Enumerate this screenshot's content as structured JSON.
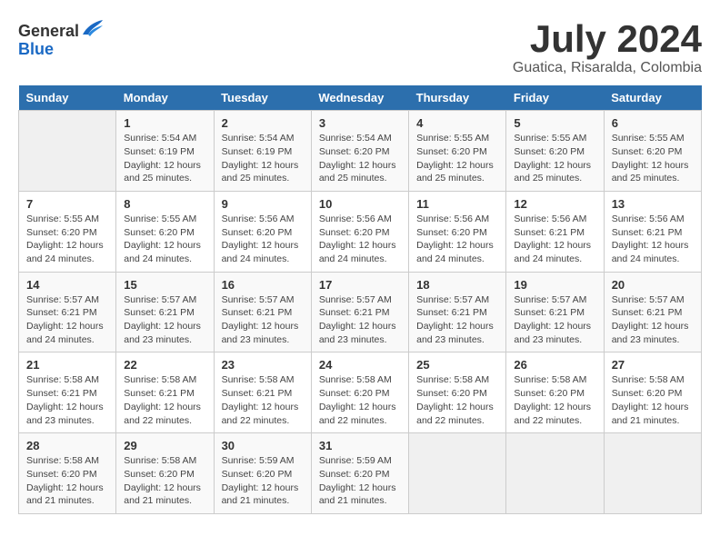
{
  "logo": {
    "general": "General",
    "blue": "Blue"
  },
  "title": "July 2024",
  "subtitle": "Guatica, Risaralda, Colombia",
  "days_header": [
    "Sunday",
    "Monday",
    "Tuesday",
    "Wednesday",
    "Thursday",
    "Friday",
    "Saturday"
  ],
  "weeks": [
    [
      {
        "day": "",
        "empty": true
      },
      {
        "day": "1",
        "sunrise": "Sunrise: 5:54 AM",
        "sunset": "Sunset: 6:19 PM",
        "daylight": "Daylight: 12 hours and 25 minutes."
      },
      {
        "day": "2",
        "sunrise": "Sunrise: 5:54 AM",
        "sunset": "Sunset: 6:19 PM",
        "daylight": "Daylight: 12 hours and 25 minutes."
      },
      {
        "day": "3",
        "sunrise": "Sunrise: 5:54 AM",
        "sunset": "Sunset: 6:20 PM",
        "daylight": "Daylight: 12 hours and 25 minutes."
      },
      {
        "day": "4",
        "sunrise": "Sunrise: 5:55 AM",
        "sunset": "Sunset: 6:20 PM",
        "daylight": "Daylight: 12 hours and 25 minutes."
      },
      {
        "day": "5",
        "sunrise": "Sunrise: 5:55 AM",
        "sunset": "Sunset: 6:20 PM",
        "daylight": "Daylight: 12 hours and 25 minutes."
      },
      {
        "day": "6",
        "sunrise": "Sunrise: 5:55 AM",
        "sunset": "Sunset: 6:20 PM",
        "daylight": "Daylight: 12 hours and 25 minutes."
      }
    ],
    [
      {
        "day": "7",
        "sunrise": "Sunrise: 5:55 AM",
        "sunset": "Sunset: 6:20 PM",
        "daylight": "Daylight: 12 hours and 24 minutes."
      },
      {
        "day": "8",
        "sunrise": "Sunrise: 5:55 AM",
        "sunset": "Sunset: 6:20 PM",
        "daylight": "Daylight: 12 hours and 24 minutes."
      },
      {
        "day": "9",
        "sunrise": "Sunrise: 5:56 AM",
        "sunset": "Sunset: 6:20 PM",
        "daylight": "Daylight: 12 hours and 24 minutes."
      },
      {
        "day": "10",
        "sunrise": "Sunrise: 5:56 AM",
        "sunset": "Sunset: 6:20 PM",
        "daylight": "Daylight: 12 hours and 24 minutes."
      },
      {
        "day": "11",
        "sunrise": "Sunrise: 5:56 AM",
        "sunset": "Sunset: 6:20 PM",
        "daylight": "Daylight: 12 hours and 24 minutes."
      },
      {
        "day": "12",
        "sunrise": "Sunrise: 5:56 AM",
        "sunset": "Sunset: 6:21 PM",
        "daylight": "Daylight: 12 hours and 24 minutes."
      },
      {
        "day": "13",
        "sunrise": "Sunrise: 5:56 AM",
        "sunset": "Sunset: 6:21 PM",
        "daylight": "Daylight: 12 hours and 24 minutes."
      }
    ],
    [
      {
        "day": "14",
        "sunrise": "Sunrise: 5:57 AM",
        "sunset": "Sunset: 6:21 PM",
        "daylight": "Daylight: 12 hours and 24 minutes."
      },
      {
        "day": "15",
        "sunrise": "Sunrise: 5:57 AM",
        "sunset": "Sunset: 6:21 PM",
        "daylight": "Daylight: 12 hours and 23 minutes."
      },
      {
        "day": "16",
        "sunrise": "Sunrise: 5:57 AM",
        "sunset": "Sunset: 6:21 PM",
        "daylight": "Daylight: 12 hours and 23 minutes."
      },
      {
        "day": "17",
        "sunrise": "Sunrise: 5:57 AM",
        "sunset": "Sunset: 6:21 PM",
        "daylight": "Daylight: 12 hours and 23 minutes."
      },
      {
        "day": "18",
        "sunrise": "Sunrise: 5:57 AM",
        "sunset": "Sunset: 6:21 PM",
        "daylight": "Daylight: 12 hours and 23 minutes."
      },
      {
        "day": "19",
        "sunrise": "Sunrise: 5:57 AM",
        "sunset": "Sunset: 6:21 PM",
        "daylight": "Daylight: 12 hours and 23 minutes."
      },
      {
        "day": "20",
        "sunrise": "Sunrise: 5:57 AM",
        "sunset": "Sunset: 6:21 PM",
        "daylight": "Daylight: 12 hours and 23 minutes."
      }
    ],
    [
      {
        "day": "21",
        "sunrise": "Sunrise: 5:58 AM",
        "sunset": "Sunset: 6:21 PM",
        "daylight": "Daylight: 12 hours and 23 minutes."
      },
      {
        "day": "22",
        "sunrise": "Sunrise: 5:58 AM",
        "sunset": "Sunset: 6:21 PM",
        "daylight": "Daylight: 12 hours and 22 minutes."
      },
      {
        "day": "23",
        "sunrise": "Sunrise: 5:58 AM",
        "sunset": "Sunset: 6:21 PM",
        "daylight": "Daylight: 12 hours and 22 minutes."
      },
      {
        "day": "24",
        "sunrise": "Sunrise: 5:58 AM",
        "sunset": "Sunset: 6:20 PM",
        "daylight": "Daylight: 12 hours and 22 minutes."
      },
      {
        "day": "25",
        "sunrise": "Sunrise: 5:58 AM",
        "sunset": "Sunset: 6:20 PM",
        "daylight": "Daylight: 12 hours and 22 minutes."
      },
      {
        "day": "26",
        "sunrise": "Sunrise: 5:58 AM",
        "sunset": "Sunset: 6:20 PM",
        "daylight": "Daylight: 12 hours and 22 minutes."
      },
      {
        "day": "27",
        "sunrise": "Sunrise: 5:58 AM",
        "sunset": "Sunset: 6:20 PM",
        "daylight": "Daylight: 12 hours and 21 minutes."
      }
    ],
    [
      {
        "day": "28",
        "sunrise": "Sunrise: 5:58 AM",
        "sunset": "Sunset: 6:20 PM",
        "daylight": "Daylight: 12 hours and 21 minutes."
      },
      {
        "day": "29",
        "sunrise": "Sunrise: 5:58 AM",
        "sunset": "Sunset: 6:20 PM",
        "daylight": "Daylight: 12 hours and 21 minutes."
      },
      {
        "day": "30",
        "sunrise": "Sunrise: 5:59 AM",
        "sunset": "Sunset: 6:20 PM",
        "daylight": "Daylight: 12 hours and 21 minutes."
      },
      {
        "day": "31",
        "sunrise": "Sunrise: 5:59 AM",
        "sunset": "Sunset: 6:20 PM",
        "daylight": "Daylight: 12 hours and 21 minutes."
      },
      {
        "day": "",
        "empty": true
      },
      {
        "day": "",
        "empty": true
      },
      {
        "day": "",
        "empty": true
      }
    ]
  ]
}
